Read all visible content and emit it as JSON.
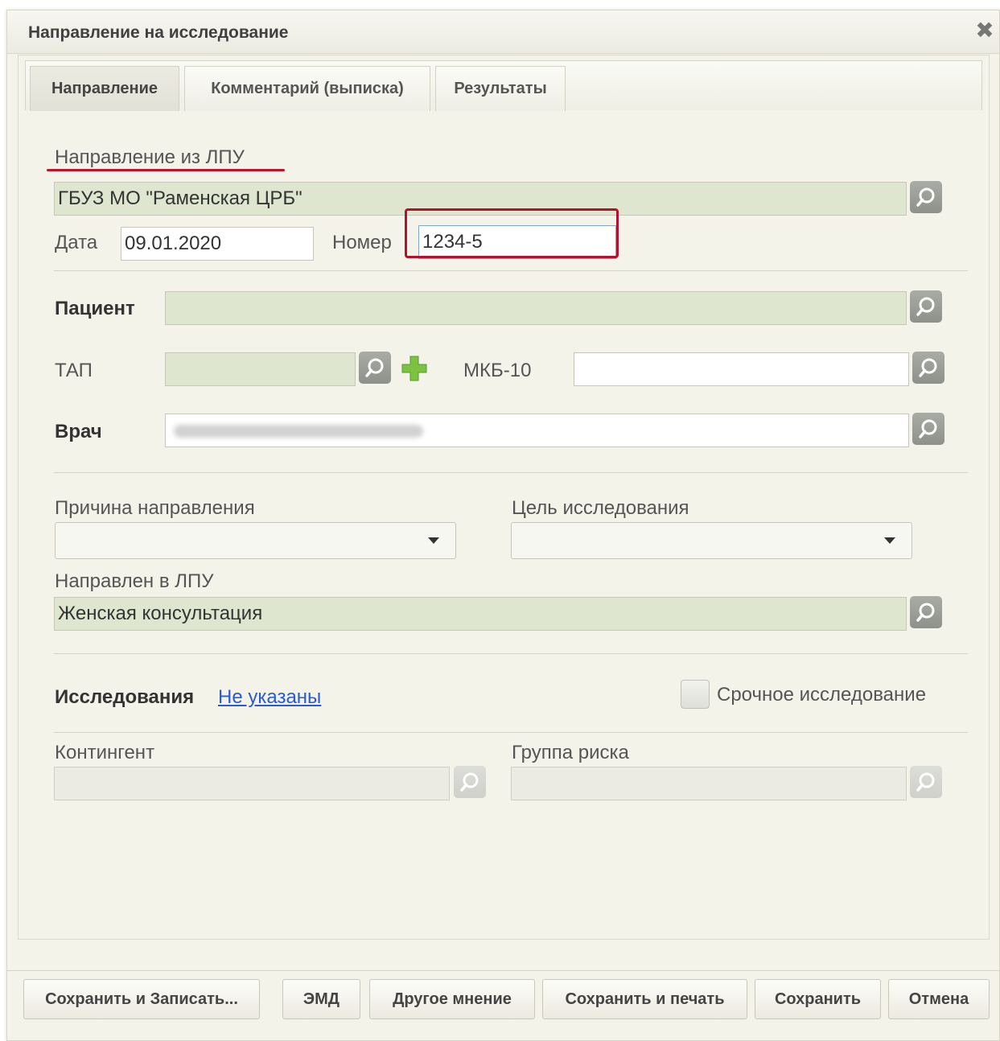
{
  "window": {
    "title": "Направление на исследование"
  },
  "tabs": [
    {
      "label": "Направление",
      "active": true
    },
    {
      "label": "Комментарий (выписка)",
      "active": false
    },
    {
      "label": "Результаты",
      "active": false
    }
  ],
  "referral": {
    "section_label": "Направление из ЛПУ",
    "org_value": "ГБУЗ МО \"Раменская ЦРБ\"",
    "date_label": "Дата",
    "date_value": "09.01.2020",
    "number_label": "Номер",
    "number_value": "1234-5"
  },
  "patient": {
    "label": "Пациент",
    "value": ""
  },
  "tap": {
    "label": "ТАП",
    "value": ""
  },
  "mkb": {
    "label": "МКБ-10",
    "value": ""
  },
  "doctor": {
    "label": "Врач",
    "value": ""
  },
  "reason": {
    "label": "Причина направления",
    "value": ""
  },
  "goal": {
    "label": "Цель исследования",
    "value": ""
  },
  "sent_to": {
    "label": "Направлен в ЛПУ",
    "value": "Женская консультация"
  },
  "research": {
    "label": "Исследования",
    "link": "Не указаны",
    "urgent_label": "Срочное исследование",
    "urgent_checked": false
  },
  "contingent": {
    "label": "Контингент",
    "value": ""
  },
  "risk_group": {
    "label": "Группа риска",
    "value": ""
  },
  "buttons": {
    "save_and_record": "Сохранить и Записать...",
    "emd": "ЭМД",
    "other_opinion": "Другое мнение",
    "save_and_print": "Сохранить и печать",
    "save": "Сохранить",
    "cancel": "Отмена"
  },
  "colors": {
    "highlight": "#b3122f",
    "field_green": "#dfe6cf",
    "link": "#2a5bd6"
  }
}
